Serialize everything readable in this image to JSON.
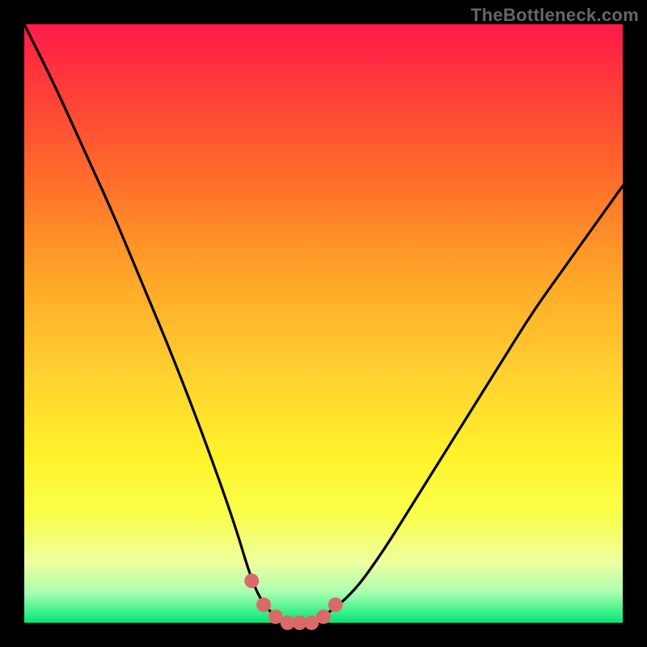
{
  "watermark": "TheBottleneck.com",
  "chart_data": {
    "type": "line",
    "title": "",
    "xlabel": "",
    "ylabel": "",
    "xlim": [
      0,
      100
    ],
    "ylim": [
      0,
      100
    ],
    "series": [
      {
        "name": "bottleneck-curve",
        "x": [
          0,
          5,
          10,
          15,
          20,
          25,
          30,
          35,
          38,
          40,
          42,
          45,
          48,
          50,
          55,
          60,
          65,
          70,
          75,
          80,
          85,
          90,
          95,
          100
        ],
        "y": [
          100,
          90,
          79,
          68,
          56,
          44,
          31,
          17,
          7,
          3,
          1,
          0,
          0,
          1,
          5,
          12,
          20,
          28,
          36,
          44,
          52,
          59,
          66,
          73
        ]
      },
      {
        "name": "highlight-dots",
        "x": [
          38,
          40,
          42,
          44,
          46,
          48,
          50,
          52
        ],
        "y": [
          7,
          3,
          1,
          0,
          0,
          0,
          1,
          3
        ]
      }
    ],
    "gradient_stops": [
      {
        "pct": 0,
        "color": "#ff1a4a"
      },
      {
        "pct": 25,
        "color": "#ff6a2a"
      },
      {
        "pct": 58,
        "color": "#ffd030"
      },
      {
        "pct": 82,
        "color": "#faff4a"
      },
      {
        "pct": 100,
        "color": "#00e676"
      }
    ]
  }
}
